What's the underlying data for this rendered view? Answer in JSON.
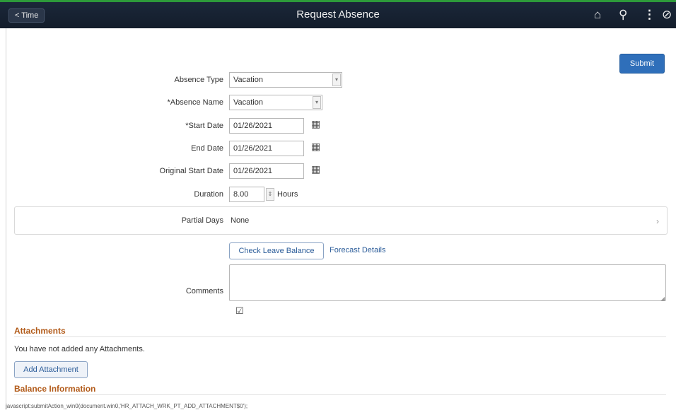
{
  "header": {
    "back_label": "< Time",
    "title": "Request Absence"
  },
  "toolbar": {
    "submit_label": "Submit"
  },
  "form": {
    "absence_type": {
      "label": "Absence Type",
      "value": "Vacation"
    },
    "absence_name": {
      "label": "*Absence Name",
      "value": "Vacation"
    },
    "start_date": {
      "label": "*Start Date",
      "value": "01/26/2021"
    },
    "end_date": {
      "label": "End Date",
      "value": "01/26/2021"
    },
    "original_start_date": {
      "label": "Original Start Date",
      "value": "01/26/2021"
    },
    "duration": {
      "label": "Duration",
      "value": "8.00",
      "unit": "Hours"
    },
    "partial_days": {
      "label": "Partial Days",
      "value": "None"
    },
    "check_balance_label": "Check Leave Balance",
    "forecast_label": "Forecast Details",
    "comments": {
      "label": "Comments",
      "value": ""
    }
  },
  "attachments": {
    "title": "Attachments",
    "empty_message": "You have not added any Attachments.",
    "add_label": "Add Attachment"
  },
  "balance": {
    "title": "Balance Information"
  },
  "status_bar": {
    "text": "javascript:submitAction_win0(document.win0,'HR_ATTACH_WRK_PT_ADD_ATTACHMENT$0');"
  }
}
